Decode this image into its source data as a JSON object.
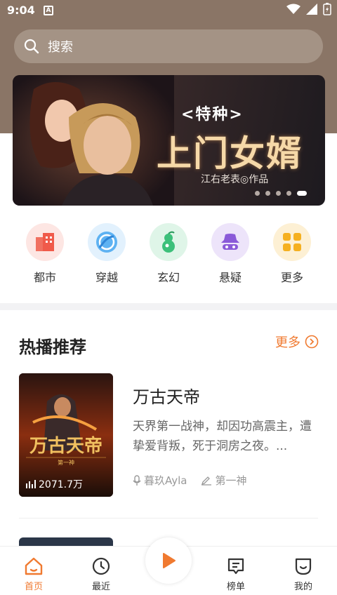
{
  "status": {
    "time": "9:04",
    "notification_glyph": "A"
  },
  "search": {
    "placeholder": "搜索"
  },
  "banner": {
    "subtitle": "<特种>",
    "title": "上门女婿",
    "author": "江右老表◎作品",
    "dots": 5,
    "active_dot": 4
  },
  "categories": [
    {
      "label": "都市",
      "icon": "city-icon",
      "color": "#f05a4a"
    },
    {
      "label": "穿越",
      "icon": "portal-icon",
      "color": "#4aa8f0"
    },
    {
      "label": "玄幻",
      "icon": "gourd-icon",
      "color": "#3cc07a"
    },
    {
      "label": "悬疑",
      "icon": "detective-icon",
      "color": "#8a5ad8"
    },
    {
      "label": "更多",
      "icon": "grid-icon",
      "color": "#f5b020"
    }
  ],
  "section": {
    "title": "热播推荐",
    "more": "更多"
  },
  "book": {
    "name": "万古天帝",
    "description": "天界第一战神，却因功高震主，遭挚爱背叛，死于洞房之夜。...",
    "narrator": "暮玖Ayla",
    "author": "第一神",
    "plays": "2071.7万",
    "cover_title": "万古天帝",
    "cover_author": "第一神"
  },
  "tabs": [
    {
      "label": "首页",
      "icon": "home-icon",
      "active": true
    },
    {
      "label": "最近",
      "icon": "clock-icon",
      "active": false
    },
    {
      "label": "榜单",
      "icon": "ranking-icon",
      "active": false
    },
    {
      "label": "我的",
      "icon": "profile-icon",
      "active": false
    }
  ],
  "colors": {
    "accent": "#f07a30",
    "header": "#8a7566"
  }
}
